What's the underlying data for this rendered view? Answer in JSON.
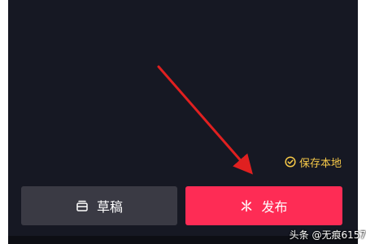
{
  "colors": {
    "screen_bg": "#161823",
    "draft_button_bg": "#3a3a44",
    "publish_button_bg": "#fe2c55",
    "save_local_color": "#f7c948",
    "annotation_arrow": "#e02020"
  },
  "save_local": {
    "label": "保存本地",
    "icon": "check-circle-icon"
  },
  "actions": {
    "draft_label": "草稿",
    "draft_icon": "draft-box-icon",
    "publish_label": "发布",
    "publish_icon": "sparkle-icon"
  },
  "watermark": {
    "text": "头条 @无痕6157"
  }
}
